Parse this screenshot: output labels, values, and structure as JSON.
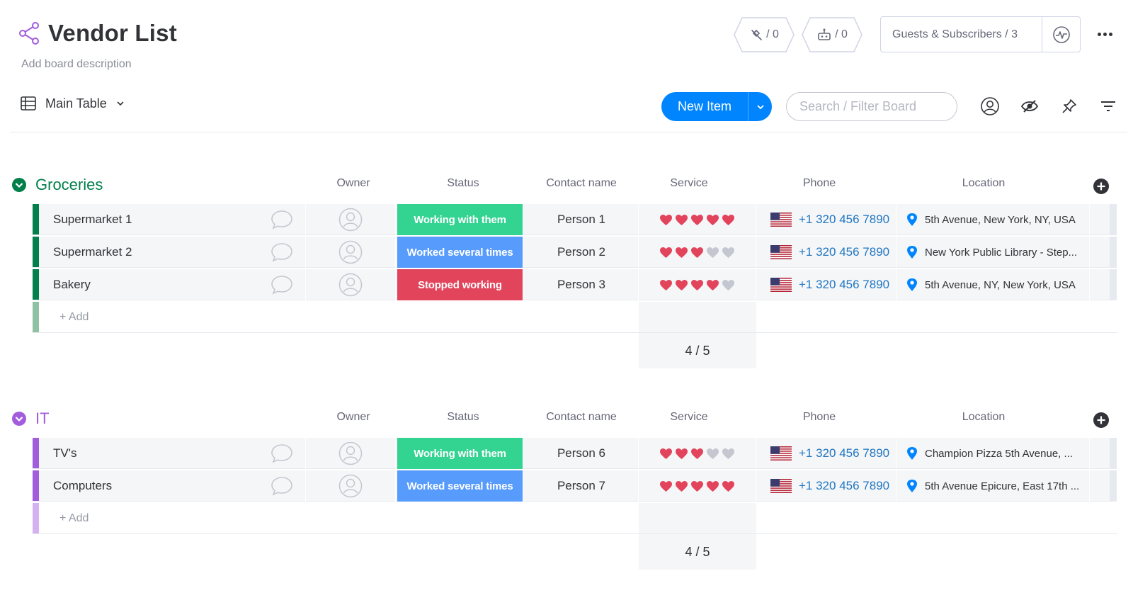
{
  "board": {
    "title": "Vendor List",
    "description": "Add board description"
  },
  "header": {
    "integrations_count": "/ 0",
    "automations_count": "/ 0",
    "guests_label": "Guests & Subscribers / 3"
  },
  "toolbar": {
    "view_label": "Main Table",
    "new_item_label": "New Item",
    "search_placeholder": "Search / Filter Board"
  },
  "columns": [
    "Owner",
    "Status",
    "Contact name",
    "Service",
    "Phone",
    "Location"
  ],
  "colors": {
    "groceries": "#037f4c",
    "groceries_light": "#8fc2a4",
    "it": "#a25ddc",
    "it_light": "#d4b2f0",
    "status_working": "#33d391",
    "status_several": "#579bfc",
    "status_stopped": "#e2445c",
    "heart_on": "#e2445c",
    "heart_off": "#c5c7d0",
    "link": "#1f76c2",
    "accent": "#0085ff"
  },
  "groups": [
    {
      "name": "Groceries",
      "add_label": "+ Add",
      "summary": "4 / 5",
      "rows": [
        {
          "name": "Supermarket 1",
          "status": "Working with them",
          "status_key": "working",
          "contact": "Person 1",
          "rating": 5,
          "phone": "+1 320 456 7890",
          "location": "5th Avenue, New York, NY, USA"
        },
        {
          "name": "Supermarket 2",
          "status": "Worked several times",
          "status_key": "several",
          "contact": "Person 2",
          "rating": 3,
          "phone": "+1 320 456 7890",
          "location": "New York Public Library - Step..."
        },
        {
          "name": "Bakery",
          "status": "Stopped working",
          "status_key": "stopped",
          "contact": "Person 3",
          "rating": 4,
          "phone": "+1 320 456 7890",
          "location": "5th Avenue, NY, New York, USA"
        }
      ]
    },
    {
      "name": "IT",
      "add_label": "+ Add",
      "summary": "4 / 5",
      "rows": [
        {
          "name": "TV's",
          "status": "Working with them",
          "status_key": "working",
          "contact": "Person 6",
          "rating": 3,
          "phone": "+1 320 456 7890",
          "location": "Champion Pizza 5th Avenue, ..."
        },
        {
          "name": "Computers",
          "status": "Worked several times",
          "status_key": "several",
          "contact": "Person 7",
          "rating": 5,
          "phone": "+1 320 456 7890",
          "location": "5th Avenue Epicure, East 17th ..."
        }
      ]
    }
  ],
  "icons": [
    "share-icon",
    "integrations-icon",
    "automations-icon",
    "activity-icon",
    "more-icon",
    "table-icon",
    "chevron-down-icon",
    "person-icon",
    "eye-off-icon",
    "pin-icon",
    "filter-icon",
    "collapse-icon",
    "add-column-icon",
    "update-bubble-icon",
    "avatar-icon",
    "heart-icon",
    "us-flag-icon",
    "location-pin-icon"
  ]
}
